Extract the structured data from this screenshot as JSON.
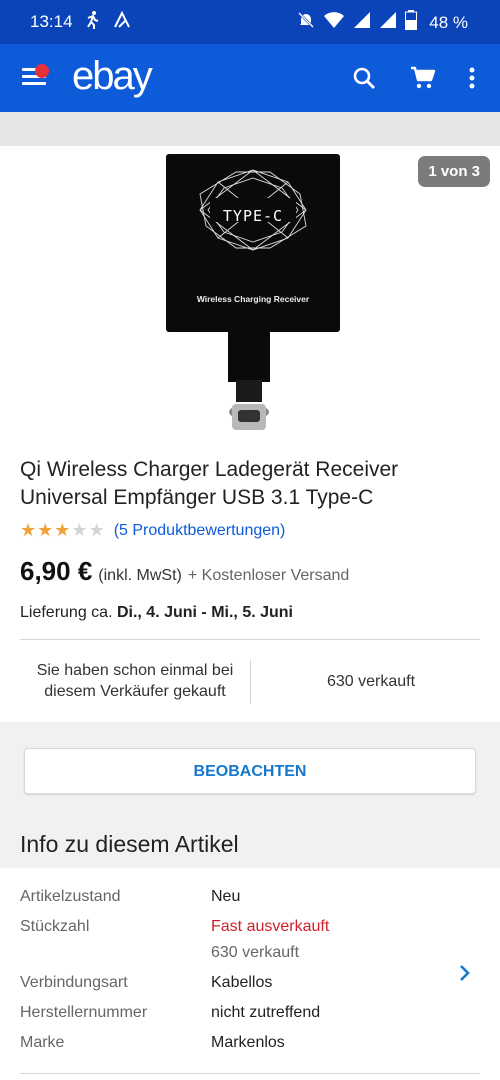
{
  "status_bar": {
    "time": "13:14",
    "battery": "48 %"
  },
  "app_bar": {
    "logo": "ebay"
  },
  "product": {
    "image_text_main": "TYPE-C",
    "image_text_sub": "Wireless Charging Receiver",
    "pager": "1 von 3",
    "title": "Qi Wireless Charger Ladegerät Receiver Universal Empfänger USB 3.1 Type-C",
    "rating_stars": 3,
    "rating_max": 5,
    "reviews_link": "(5 Produktbewertungen)",
    "price": "6,90 €",
    "vat_note": "(inkl. MwSt)",
    "shipping": "+ Kostenloser Versand",
    "delivery_label": "Lieferung ca.",
    "delivery_dates": "Di., 4. Juni - Mi., 5. Juni",
    "seller_note": "Sie haben schon einmal bei diesem Verkäufer gekauft",
    "sold": "630 verkauft"
  },
  "actions": {
    "watch": "BEOBACHTEN"
  },
  "info": {
    "title": "Info zu diesem Artikel",
    "rows": [
      {
        "key": "Artikelzustand",
        "value": "Neu"
      },
      {
        "key": "Stückzahl",
        "value": "Fast ausverkauft",
        "sub": "630 verkauft"
      },
      {
        "key": "Verbindungsart",
        "value": "Kabellos"
      },
      {
        "key": "Herstellernummer",
        "value": "nicht zutreffend"
      },
      {
        "key": "Marke",
        "value": "Markenlos"
      }
    ]
  },
  "colors": {
    "appbar": "#0d5bd9",
    "statusbar": "#0b44b8",
    "link": "#0d5bd9",
    "star": "#f0a33a",
    "alert_red": "#d0202b"
  }
}
